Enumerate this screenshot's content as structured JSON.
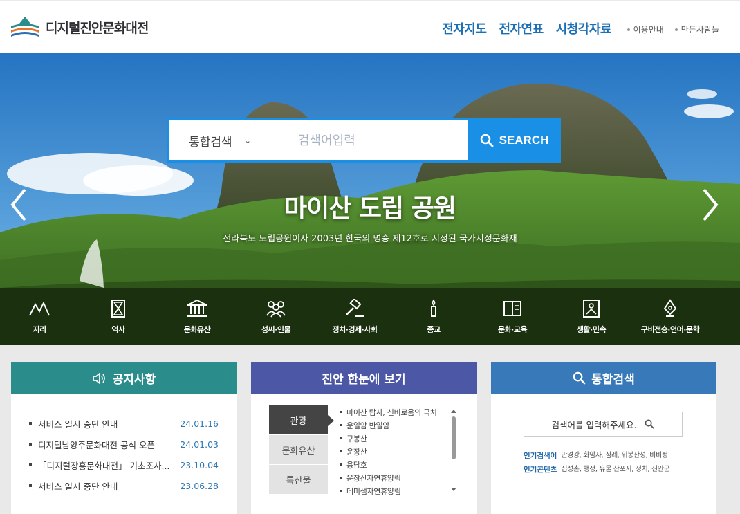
{
  "site": {
    "logo_text": "디지털진안문화대전"
  },
  "nav": {
    "main": [
      "전자지도",
      "전자연표",
      "시청각자료"
    ],
    "sub": [
      "이용안내",
      "만든사람들"
    ]
  },
  "search": {
    "select_value": "통합검색",
    "placeholder": "검색어입력",
    "button_label": "SEARCH"
  },
  "hero": {
    "title": "마이산 도립 공원",
    "subtitle": "전라북도 도립공원이자 2003년 한국의 명승 제12호로 지정된 국가지정문화재"
  },
  "categories": [
    {
      "label": "지리",
      "icon": "mountain-icon"
    },
    {
      "label": "역사",
      "icon": "hourglass-icon"
    },
    {
      "label": "문화유산",
      "icon": "temple-icon"
    },
    {
      "label": "성씨·인물",
      "icon": "people-icon"
    },
    {
      "label": "정치·경제·사회",
      "icon": "gavel-icon"
    },
    {
      "label": "종교",
      "icon": "candle-icon"
    },
    {
      "label": "문화·교육",
      "icon": "book-icon"
    },
    {
      "label": "생활·민속",
      "icon": "frame-icon"
    },
    {
      "label": "구비전승·언어·문학",
      "icon": "pen-icon"
    }
  ],
  "notice": {
    "title": "공지사항",
    "items": [
      {
        "title": "서비스 일시 중단 안내",
        "date": "24.01.16"
      },
      {
        "title": "디지털남양주문화대전 공식 오픈",
        "date": "24.01.03"
      },
      {
        "title": "「디지털장흥문화대전」 기초조사...",
        "date": "23.10.04"
      },
      {
        "title": "서비스 일시 중단 안내",
        "date": "23.06.28"
      }
    ]
  },
  "glance": {
    "title": "진안 한눈에 보기",
    "tabs": [
      "관광",
      "문화유산",
      "특산물"
    ],
    "items": [
      "마이산 탑사, 신비로움의 극치",
      "운일암 반일암",
      "구봉산",
      "운장산",
      "용담호",
      "운장산자연휴양림",
      "데미샘자연휴양림"
    ]
  },
  "integrated": {
    "title": "통합검색",
    "placeholder": "검색어를 입력해주세요.",
    "popular_search_label": "인기검색어",
    "popular_search": "만경강, 화암사, 삼례, 위봉산성, 비비정",
    "popular_content_label": "인기콘텐츠",
    "popular_content": "집성촌, 행정, 유물 산포지, 정치, 진안군"
  },
  "colors": {
    "accent": "#1a8fe6",
    "nav": "#1d6fb4",
    "notice": "#2a8d8c",
    "glance": "#4c58a5",
    "search": "#3879b9"
  }
}
